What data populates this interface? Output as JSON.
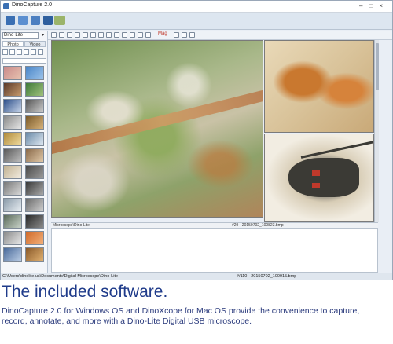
{
  "window": {
    "title": "DinoCapture 2.0"
  },
  "toolbar": {
    "magnification_label": "Mag"
  },
  "left_panel": {
    "camera_select": "Dino-Lite",
    "tabs": [
      "Photo",
      "Video"
    ]
  },
  "main_view": {
    "tag": ""
  },
  "right_top": {
    "tag": ""
  },
  "status_strip": {
    "left": "Microscope\\Dino-Lite",
    "right": "#29 - 20150702_100823.bmp"
  },
  "bottom_status": {
    "path": "C:\\Users\\dinolite.us\\Documents\\Digital Microscope\\Dino-Lite",
    "file": "#/110 - 20150702_100915.bmp"
  },
  "headline": "The included software.",
  "description": "DinoCapture 2.0 for Windows OS and DinoXcope for Mac OS provide the convenience to capture, record, annotate, and more with a Dino-Lite Digital USB microscope.",
  "colors": {
    "headline": "#1f3b8a",
    "body_text": "#2a3a7c",
    "ribbon": "#dde6f0"
  },
  "icons": [
    "app-icon",
    "minimize-icon",
    "maximize-icon",
    "close-icon",
    "camera-icon",
    "settings-icon",
    "folder-icon",
    "zoom-icon"
  ]
}
